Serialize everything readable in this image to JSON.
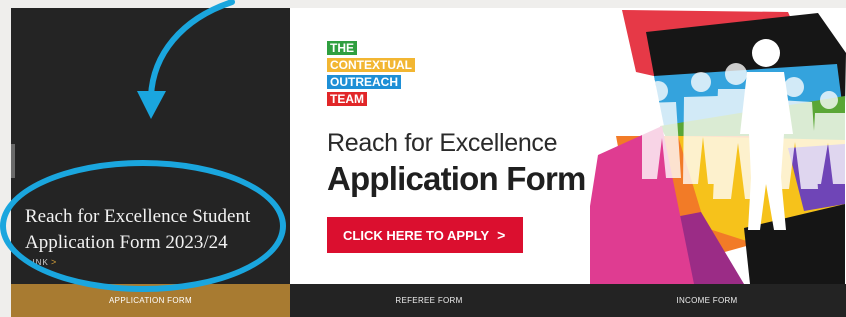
{
  "left_panel": {
    "title": "Reach for Excellence Student Application Form 2023/24",
    "link_label": "LINK",
    "link_chevron": ">"
  },
  "banner": {
    "team_lines": [
      "THE",
      "CONTEXTUAL",
      "OUTREACH",
      "TEAM"
    ],
    "reach_text": "Reach for Excellence",
    "app_text": "Application Form",
    "apply_button": "CLICK HERE TO APPLY",
    "apply_arrow": ">"
  },
  "nav": {
    "tabs": [
      "APPLICATION FORM",
      "REFEREE FORM",
      "INCOME FORM"
    ],
    "active_index": 0
  },
  "colors": {
    "left_panel": "#242424",
    "nav_active": "#a87b31",
    "apply_button": "#db0f2f",
    "team_green": "#2f9f3f",
    "team_yellow": "#f2b632",
    "team_blue": "#1e8fd6",
    "team_red": "#e12628",
    "annotation": "#1aa6de"
  },
  "icons": {
    "annotation_arrow": "curved-arrow-icon",
    "annotation_highlight": "circle-highlight-icon",
    "link_chevron": "chevron-right-icon",
    "apply_arrow": "chevron-right-icon"
  }
}
